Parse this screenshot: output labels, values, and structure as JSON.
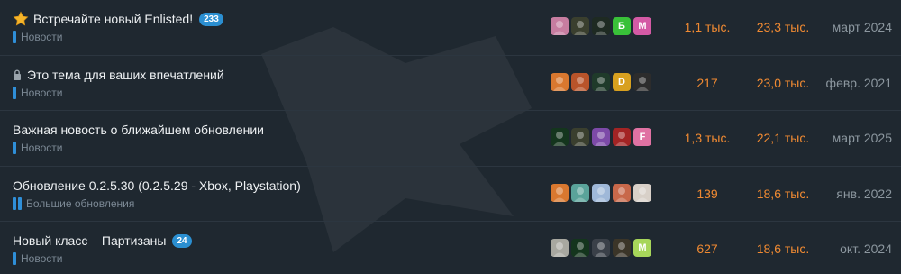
{
  "topics": [
    {
      "title": "Встречайте новый Enlisted!",
      "icon": "star-icon",
      "reply_badge": "233",
      "category": "Новости",
      "avatars": [
        {
          "kind": "image",
          "name": "avatar-pink-character",
          "bg": "#c77da0"
        },
        {
          "kind": "image",
          "name": "avatar-dark-creature",
          "bg": "#3a3f2e"
        },
        {
          "kind": "image",
          "name": "avatar-soldier",
          "bg": "#1e2a22"
        },
        {
          "kind": "letter",
          "letter": "Б",
          "bg": "#39c139"
        },
        {
          "kind": "letter",
          "letter": "M",
          "bg": "#d45aa5"
        }
      ],
      "replies": "1,1 тыс.",
      "views": "23,3 тыс.",
      "activity": "март 2024"
    },
    {
      "title": "Это тема для ваших впечатлений",
      "icon": "lock-icon",
      "reply_badge": "",
      "category": "Новости",
      "avatars": [
        {
          "kind": "image",
          "name": "avatar-fox",
          "bg": "#d9782f"
        },
        {
          "kind": "image",
          "name": "avatar-fox-red",
          "bg": "#b9542a"
        },
        {
          "kind": "image",
          "name": "avatar-green-dark",
          "bg": "#1f3a2a"
        },
        {
          "kind": "letter",
          "letter": "D",
          "bg": "#d8a01f"
        },
        {
          "kind": "image",
          "name": "avatar-gas-mask",
          "bg": "#2c2c2c"
        }
      ],
      "replies": "217",
      "views": "23,0 тыс.",
      "activity": "февр. 2021"
    },
    {
      "title": "Важная новость о ближайшем обновлении",
      "icon": "",
      "reply_badge": "",
      "category": "Новости",
      "avatars": [
        {
          "kind": "image",
          "name": "avatar-green-swirl",
          "bg": "#14351d"
        },
        {
          "kind": "image",
          "name": "avatar-dark-creature",
          "bg": "#3a3f2e"
        },
        {
          "kind": "image",
          "name": "avatar-colorful",
          "bg": "#7d4aa8"
        },
        {
          "kind": "image",
          "name": "avatar-red-emblem",
          "bg": "#a32424"
        },
        {
          "kind": "letter",
          "letter": "F",
          "bg": "#e072a3"
        }
      ],
      "replies": "1,3 тыс.",
      "views": "22,1 тыс.",
      "activity": "март 2025"
    },
    {
      "title": "Обновление 0.2.5.30 (0.2.5.29 - Xbox, Playstation)",
      "icon": "",
      "reply_badge": "",
      "category": "Большие обновления",
      "avatars": [
        {
          "kind": "image",
          "name": "avatar-fox",
          "bg": "#d9782f"
        },
        {
          "kind": "image",
          "name": "avatar-teal-creature",
          "bg": "#5aa39a"
        },
        {
          "kind": "image",
          "name": "avatar-snow-scene",
          "bg": "#9fb8d8"
        },
        {
          "kind": "image",
          "name": "avatar-ornament",
          "bg": "#c8684a"
        },
        {
          "kind": "image",
          "name": "avatar-pale-figure",
          "bg": "#d8d0c8"
        }
      ],
      "replies": "139",
      "views": "18,6 тыс.",
      "activity": "янв. 2022"
    },
    {
      "title": "Новый класс – Партизаны",
      "icon": "",
      "reply_badge": "24",
      "category": "Новости",
      "avatars": [
        {
          "kind": "image",
          "name": "avatar-white-creature",
          "bg": "#a8a8a0"
        },
        {
          "kind": "image",
          "name": "avatar-green-swirl",
          "bg": "#14351d"
        },
        {
          "kind": "image",
          "name": "avatar-dark-figure",
          "bg": "#3a4048"
        },
        {
          "kind": "image",
          "name": "avatar-bearded-man",
          "bg": "#3b3528"
        },
        {
          "kind": "letter",
          "letter": "M",
          "bg": "#a7d65a"
        }
      ],
      "replies": "627",
      "views": "18,6 тыс.",
      "activity": "окт. 2024"
    }
  ],
  "colors": {
    "background": "#1f2830",
    "accent_orange": "#f08a32",
    "category_blue": "#2f8fd8",
    "badge_blue": "#2b8fd1"
  }
}
